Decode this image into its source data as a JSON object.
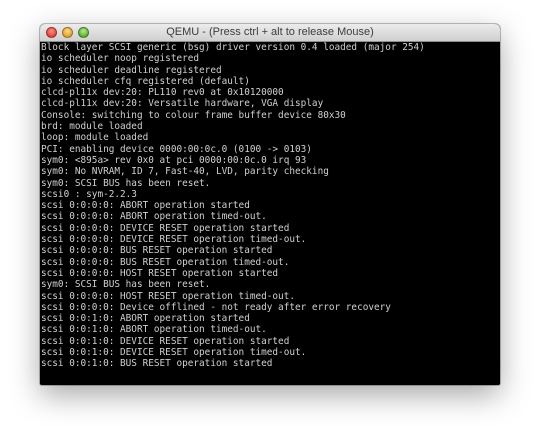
{
  "window": {
    "title": "QEMU - (Press ctrl + alt to release Mouse)"
  },
  "console": {
    "lines": [
      "Block layer SCSI generic (bsg) driver version 0.4 loaded (major 254)",
      "io scheduler noop registered",
      "io scheduler deadline registered",
      "io scheduler cfq registered (default)",
      "clcd-pl11x dev:20: PL110 rev0 at 0x10120000",
      "clcd-pl11x dev:20: Versatile hardware, VGA display",
      "Console: switching to colour frame buffer device 80x30",
      "brd: module loaded",
      "loop: module loaded",
      "PCI: enabling device 0000:00:0c.0 (0100 -> 0103)",
      "sym0: <895a> rev 0x0 at pci 0000:00:0c.0 irq 93",
      "sym0: No NVRAM, ID 7, Fast-40, LVD, parity checking",
      "sym0: SCSI BUS has been reset.",
      "scsi0 : sym-2.2.3",
      "scsi 0:0:0:0: ABORT operation started",
      "scsi 0:0:0:0: ABORT operation timed-out.",
      "scsi 0:0:0:0: DEVICE RESET operation started",
      "scsi 0:0:0:0: DEVICE RESET operation timed-out.",
      "scsi 0:0:0:0: BUS RESET operation started",
      "scsi 0:0:0:0: BUS RESET operation timed-out.",
      "scsi 0:0:0:0: HOST RESET operation started",
      "sym0: SCSI BUS has been reset.",
      "scsi 0:0:0:0: HOST RESET operation timed-out.",
      "scsi 0:0:0:0: Device offlined - not ready after error recovery",
      "scsi 0:0:1:0: ABORT operation started",
      "scsi 0:0:1:0: ABORT operation timed-out.",
      "scsi 0:0:1:0: DEVICE RESET operation started",
      "scsi 0:0:1:0: DEVICE RESET operation timed-out.",
      "scsi 0:0:1:0: BUS RESET operation started"
    ]
  },
  "colors": {
    "terminal_background": "#000000",
    "terminal_text": "#d0d0d0",
    "close_button": "#e2453c",
    "minimize_button": "#e3a32b",
    "zoom_button": "#5eb133"
  },
  "icons": {
    "close": "close-button-icon",
    "minimize": "minimize-button-icon",
    "zoom": "zoom-button-icon"
  }
}
